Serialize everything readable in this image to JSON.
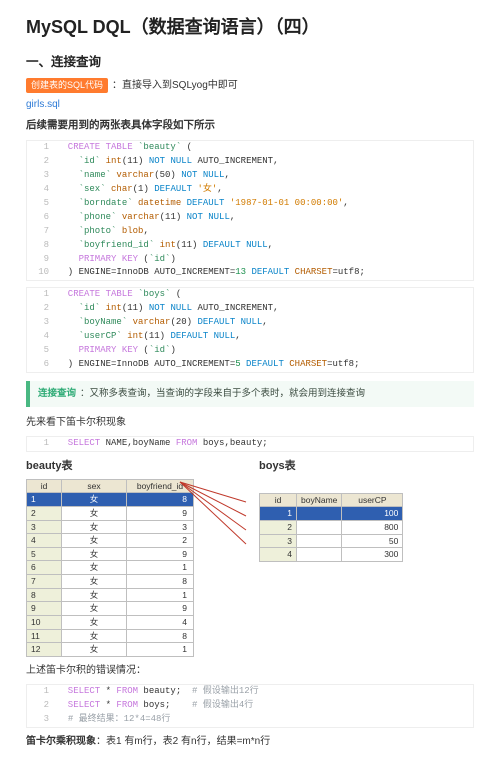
{
  "title": "MySQL DQL（数据查询语言）（四）",
  "section1": "一、连接查询",
  "introTag": "创建表的SQL代码",
  "introText": "：直接导入到SQLyog中即可",
  "sqlLink": "girls.sql",
  "preTablesLine": "后续需要用到的两张表具体字段如下所示",
  "code1": [
    {
      "c": "kw",
      "t": "  CREATE TABLE "
    },
    {
      "c": "ident",
      "t": "`beauty`"
    },
    {
      "t": " ("
    },
    null,
    {
      "t": "    "
    },
    {
      "c": "ident",
      "t": "`id`"
    },
    {
      "t": " "
    },
    {
      "c": "type",
      "t": "int"
    },
    {
      "t": "(11) "
    },
    {
      "c": "kw2",
      "t": "NOT NULL"
    },
    {
      "t": " AUTO_INCREMENT,"
    },
    null,
    {
      "t": "    "
    },
    {
      "c": "ident",
      "t": "`name`"
    },
    {
      "t": " "
    },
    {
      "c": "type",
      "t": "varchar"
    },
    {
      "t": "(50) "
    },
    {
      "c": "kw2",
      "t": "NOT NULL"
    },
    {
      "t": ","
    },
    null,
    {
      "t": "    "
    },
    {
      "c": "ident",
      "t": "`sex`"
    },
    {
      "t": " "
    },
    {
      "c": "type",
      "t": "char"
    },
    {
      "t": "(1) "
    },
    {
      "c": "kw2",
      "t": "DEFAULT "
    },
    {
      "c": "str",
      "t": "'女'"
    },
    {
      "t": ","
    },
    null,
    {
      "t": "    "
    },
    {
      "c": "ident",
      "t": "`borndate`"
    },
    {
      "t": " "
    },
    {
      "c": "type",
      "t": "datetime"
    },
    {
      "t": " "
    },
    {
      "c": "kw2",
      "t": "DEFAULT "
    },
    {
      "c": "str",
      "t": "'1987-01-01 00:00:00'"
    },
    {
      "t": ","
    },
    null,
    {
      "t": "    "
    },
    {
      "c": "ident",
      "t": "`phone`"
    },
    {
      "t": " "
    },
    {
      "c": "type",
      "t": "varchar"
    },
    {
      "t": "(11) "
    },
    {
      "c": "kw2",
      "t": "NOT NULL"
    },
    {
      "t": ","
    },
    null,
    {
      "t": "    "
    },
    {
      "c": "ident",
      "t": "`photo`"
    },
    {
      "t": " "
    },
    {
      "c": "type",
      "t": "blob"
    },
    {
      "t": ","
    },
    null,
    {
      "t": "    "
    },
    {
      "c": "ident",
      "t": "`boyfriend_id`"
    },
    {
      "t": " "
    },
    {
      "c": "type",
      "t": "int"
    },
    {
      "t": "(11) "
    },
    {
      "c": "kw2",
      "t": "DEFAULT NULL"
    },
    {
      "t": ","
    },
    null,
    {
      "t": "    "
    },
    {
      "c": "kw",
      "t": "PRIMARY KEY"
    },
    {
      "t": " ("
    },
    {
      "c": "ident",
      "t": "`id`"
    },
    {
      "t": ")"
    },
    null,
    {
      "t": "  ) ENGINE=InnoDB AUTO_INCREMENT="
    },
    {
      "c": "num",
      "t": "13"
    },
    {
      "t": " "
    },
    {
      "c": "kw2",
      "t": "DEFAULT"
    },
    {
      "t": " "
    },
    {
      "c": "type",
      "t": "CHARSET"
    },
    {
      "t": "=utf8;"
    },
    null
  ],
  "code2": [
    {
      "c": "kw",
      "t": "  CREATE TABLE "
    },
    {
      "c": "ident",
      "t": "`boys`"
    },
    {
      "t": " ("
    },
    null,
    {
      "t": "    "
    },
    {
      "c": "ident",
      "t": "`id`"
    },
    {
      "t": " "
    },
    {
      "c": "type",
      "t": "int"
    },
    {
      "t": "(11) "
    },
    {
      "c": "kw2",
      "t": "NOT NULL"
    },
    {
      "t": " AUTO_INCREMENT,"
    },
    null,
    {
      "t": "    "
    },
    {
      "c": "ident",
      "t": "`boyName`"
    },
    {
      "t": " "
    },
    {
      "c": "type",
      "t": "varchar"
    },
    {
      "t": "(20) "
    },
    {
      "c": "kw2",
      "t": "DEFAULT NULL"
    },
    {
      "t": ","
    },
    null,
    {
      "t": "    "
    },
    {
      "c": "ident",
      "t": "`userCP`"
    },
    {
      "t": " "
    },
    {
      "c": "type",
      "t": "int"
    },
    {
      "t": "(11) "
    },
    {
      "c": "kw2",
      "t": "DEFAULT NULL"
    },
    {
      "t": ","
    },
    null,
    {
      "t": "    "
    },
    {
      "c": "kw",
      "t": "PRIMARY KEY"
    },
    {
      "t": " ("
    },
    {
      "c": "ident",
      "t": "`id`"
    },
    {
      "t": ")"
    },
    null,
    {
      "t": "  ) ENGINE=InnoDB AUTO_INCREMENT="
    },
    {
      "c": "num",
      "t": "5"
    },
    {
      "t": " "
    },
    {
      "c": "kw2",
      "t": "DEFAULT"
    },
    {
      "t": " "
    },
    {
      "c": "type",
      "t": "CHARSET"
    },
    {
      "t": "=utf8;"
    },
    null
  ],
  "calloutLabel": "连接查询",
  "calloutText": "：又称多表查询，当查询的字段来自于多个表时，就会用到连接查询",
  "beforeCartesian": "先来看下笛卡尔积现象",
  "code3": [
    {
      "c": "kw",
      "t": "  SELECT"
    },
    {
      "t": " NAME,boyName "
    },
    {
      "c": "kw",
      "t": "FROM"
    },
    {
      "t": " boys,beauty;"
    },
    null
  ],
  "beautyTitle": "beauty表",
  "boysTitle": "boys表",
  "beautyHeaders": [
    "id",
    "sex",
    "boyfriend_id"
  ],
  "beautyRows": [
    [
      "1",
      "女",
      "8"
    ],
    [
      "2",
      "女",
      "9"
    ],
    [
      "3",
      "女",
      "3"
    ],
    [
      "4",
      "女",
      "2"
    ],
    [
      "5",
      "女",
      "9"
    ],
    [
      "6",
      "女",
      "1"
    ],
    [
      "7",
      "女",
      "8"
    ],
    [
      "8",
      "女",
      "1"
    ],
    [
      "9",
      "女",
      "9"
    ],
    [
      "10",
      "女",
      "4"
    ],
    [
      "11",
      "女",
      "8"
    ],
    [
      "12",
      "女",
      "1"
    ]
  ],
  "boysHeaders": [
    "id",
    "boyName",
    "userCP"
  ],
  "boysRows": [
    [
      "1",
      "",
      "100"
    ],
    [
      "2",
      "",
      "800"
    ],
    [
      "3",
      "",
      "50"
    ],
    [
      "4",
      "",
      "300"
    ]
  ],
  "afterTablesLine": "上述笛卡尔积的错误情况：",
  "code4": [
    {
      "c": "kw",
      "t": "  SELECT"
    },
    {
      "t": " * "
    },
    {
      "c": "kw",
      "t": "FROM"
    },
    {
      "t": " beauty;  "
    },
    {
      "c": "cmt",
      "t": "# 假设输出12行"
    },
    null,
    {
      "c": "kw",
      "t": "  SELECT"
    },
    {
      "t": " * "
    },
    {
      "c": "kw",
      "t": "FROM"
    },
    {
      "t": " boys;    "
    },
    {
      "c": "cmt",
      "t": "# 假设输出4行"
    },
    null,
    {
      "t": "  "
    },
    {
      "c": "cmt",
      "t": "# 最终结果：12*4=48行"
    },
    null
  ],
  "summaryLabel": "笛卡尔乘积现象",
  "summaryText": "：表1 有m行，表2 有n行，结果=m*n行"
}
